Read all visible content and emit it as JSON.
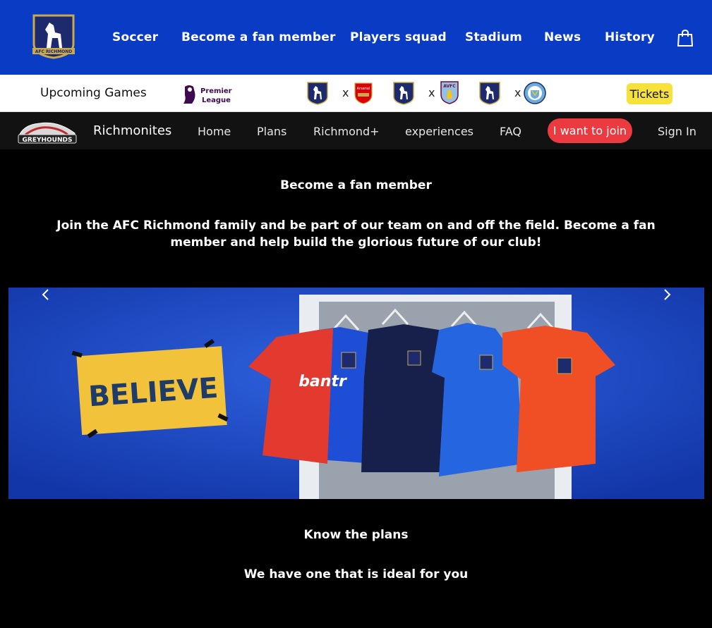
{
  "topnav": {
    "crest_label": "AFC RICHMOND",
    "items": [
      {
        "label": "Soccer"
      },
      {
        "label": "Become a fan member"
      },
      {
        "label": "Players squad"
      },
      {
        "label": "Stadium"
      },
      {
        "label": "News"
      },
      {
        "label": "History"
      }
    ],
    "bag_icon": "shopping-bag-icon",
    "bg_color": "#0a3bc4"
  },
  "gamesbar": {
    "upcoming_label": "Upcoming Games",
    "league_logo_text": [
      "Premier",
      "League"
    ],
    "matches": [
      {
        "vs": "x",
        "home_icon": "richmond-crest-icon",
        "away_icon": "arsenal-crest-icon",
        "away_text": "Arsenal"
      },
      {
        "vs": "x",
        "home_icon": "richmond-crest-icon",
        "away_icon": "aston-villa-crest-icon",
        "away_text": "AVFC"
      },
      {
        "vs": "x",
        "home_icon": "richmond-crest-icon",
        "away_icon": "manchester-city-crest-icon",
        "away_text": ""
      }
    ],
    "tickets_label": "Tickets",
    "tickets_color": "#f6e23a"
  },
  "subnav": {
    "logo_text": "GREYHOUNDS",
    "brand": "Richmonites",
    "items": [
      {
        "label": "Home"
      },
      {
        "label": "Plans"
      },
      {
        "label": "Richmond+"
      },
      {
        "label": "experiences"
      },
      {
        "label": "FAQ"
      }
    ],
    "join_label": "I want to join",
    "join_color": "#ec3b40",
    "signin_label": "Sign In"
  },
  "main": {
    "title": "Become a fan member",
    "lead": "Join the AFC Richmond family and be part of our team on and off the field. Become a fan member and help build the glorious future of our club!",
    "carousel": {
      "sign_text": "BELIEVE",
      "shirt_text": "bantr",
      "prev_icon": "chevron-left-icon",
      "next_icon": "chevron-right-icon"
    },
    "plans_title": "Know the plans",
    "plans_sub": "We have one that is ideal for you"
  }
}
